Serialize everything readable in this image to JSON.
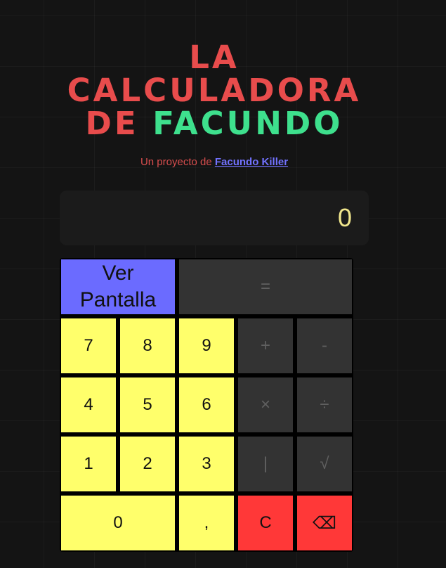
{
  "header": {
    "title_line1": "LA",
    "title_line2": "CALCULADORA",
    "title_line3_prefix": "DE",
    "title_line3_accent": "FACUNDO",
    "subtitle_prefix": "Un proyecto de",
    "subtitle_link": "Facundo Killer"
  },
  "display": {
    "value": "0"
  },
  "keys": {
    "ver_pantalla": "Ver\nPantalla",
    "equals": "=",
    "seven": "7",
    "eight": "8",
    "nine": "9",
    "plus": "+",
    "minus": "-",
    "four": "4",
    "five": "5",
    "six": "6",
    "multiply": "×",
    "divide": "÷",
    "one": "1",
    "two": "2",
    "three": "3",
    "pipe": "|",
    "sqrt": "√",
    "zero": "0",
    "comma": ",",
    "clear": "C",
    "backspace": "⌫"
  },
  "colors": {
    "title_red": "#e84c4c",
    "title_green": "#3ee08d",
    "link_blue": "#7272ff",
    "digit_key": "#ffff6b",
    "operator_key": "#333333",
    "danger_key": "#ff3838",
    "view_key": "#6b6bff",
    "display_text": "#f0e68c"
  }
}
